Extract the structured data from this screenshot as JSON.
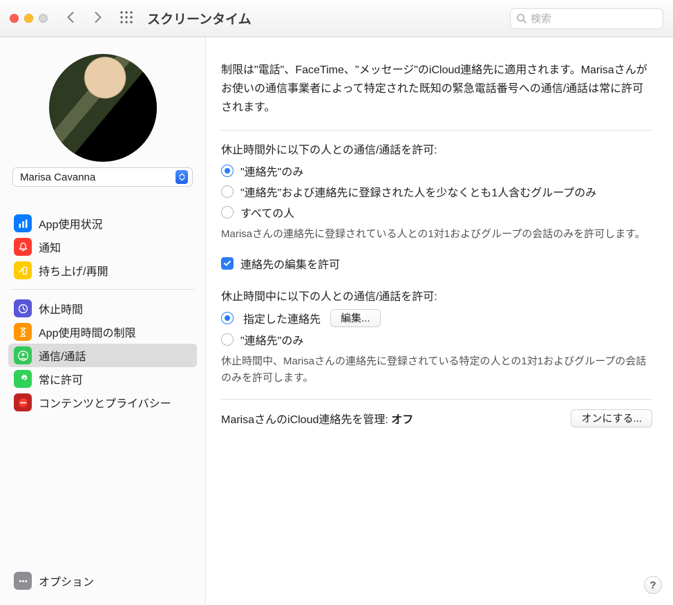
{
  "window": {
    "title": "スクリーンタイム",
    "search_placeholder": "検索"
  },
  "user": {
    "name": "Marisa Cavanna"
  },
  "sidebar": {
    "groups": [
      {
        "items": [
          {
            "id": "app-usage",
            "label": "App使用状況",
            "icon": "bars-icon",
            "color": "blue"
          },
          {
            "id": "notifications",
            "label": "通知",
            "icon": "bell-icon",
            "color": "red"
          },
          {
            "id": "pickups",
            "label": "持ち上げ/再開",
            "icon": "pickup-icon",
            "color": "yellow"
          }
        ]
      },
      {
        "items": [
          {
            "id": "downtime",
            "label": "休止時間",
            "icon": "clock-icon",
            "color": "purple"
          },
          {
            "id": "app-limits",
            "label": "App使用時間の制限",
            "icon": "hourglass-icon",
            "color": "orange"
          },
          {
            "id": "communication",
            "label": "通信/通話",
            "icon": "person-icon",
            "color": "green",
            "selected": true
          },
          {
            "id": "always-allow",
            "label": "常に許可",
            "icon": "check-seal-icon",
            "color": "green2"
          },
          {
            "id": "content",
            "label": "コンテンツとプライバシー",
            "icon": "noentry-icon",
            "color": "darkred"
          }
        ]
      }
    ],
    "options_label": "オプション"
  },
  "main": {
    "intro": "制限は\"電話\"、FaceTime、\"メッセージ\"のiCloud連絡先に適用されます。Marisaさんがお使いの通信事業者によって特定された既知の緊急電話番号への通信/通話は常に許可されます。",
    "outside_downtime": {
      "header": "休止時間外に以下の人との通信/通話を許可:",
      "options": [
        {
          "id": "contacts-only",
          "label": "\"連絡先\"のみ",
          "checked": true
        },
        {
          "id": "contacts-groups",
          "label": "\"連絡先\"および連絡先に登録された人を少なくとも1人含むグループのみ",
          "checked": false
        },
        {
          "id": "everyone",
          "label": "すべての人",
          "checked": false
        }
      ],
      "note": "Marisaさんの連絡先に登録されている人との1対1およびグループの会話のみを許可します。"
    },
    "allow_editing": {
      "label": "連絡先の編集を許可",
      "checked": true
    },
    "during_downtime": {
      "header": "休止時間中に以下の人との通信/通話を許可:",
      "options": [
        {
          "id": "specific",
          "label": "指定した連絡先",
          "checked": true,
          "edit_label": "編集..."
        },
        {
          "id": "contacts-only-2",
          "label": "\"連絡先\"のみ",
          "checked": false
        }
      ],
      "note": "休止時間中、Marisaさんの連絡先に登録されている特定の人との1対1およびグループの会話のみを許可します。"
    },
    "manage": {
      "label_prefix": "MarisaさんのiCloud連絡先を管理: ",
      "status": "オフ",
      "button": "オンにする..."
    }
  },
  "help_label": "?"
}
